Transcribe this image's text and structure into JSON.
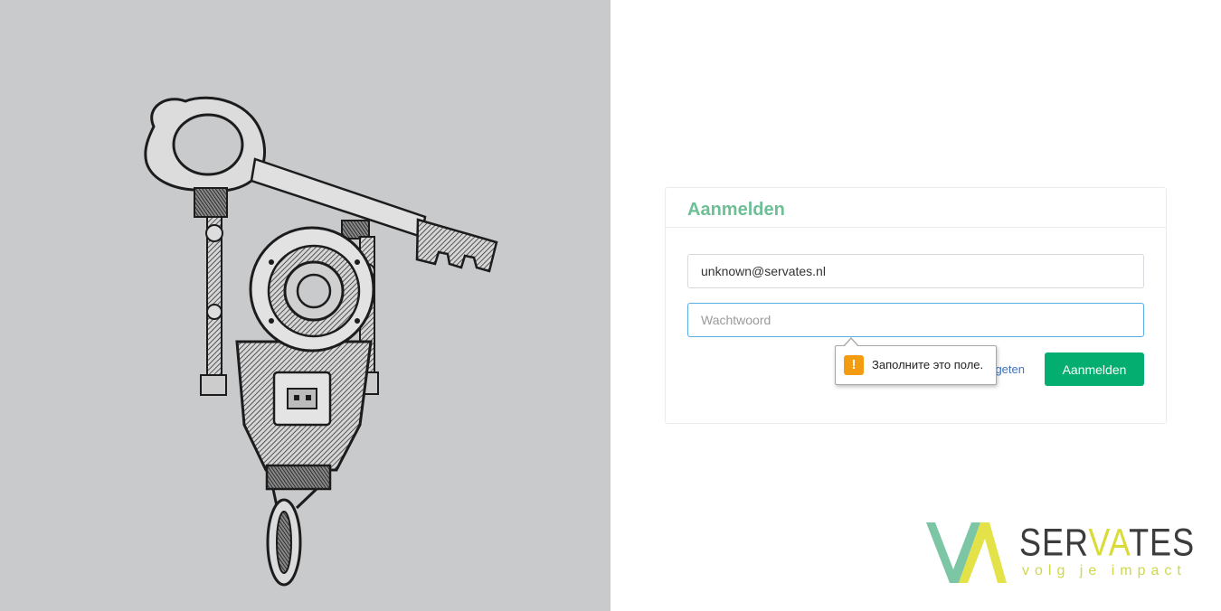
{
  "login": {
    "title": "Aanmelden",
    "email_value": "unknown@servates.nl",
    "password_placeholder": "Wachtwoord",
    "forgot_link": "geten",
    "submit_label": "Aanmelden"
  },
  "tooltip": {
    "icon": "warning-icon",
    "icon_glyph": "!",
    "text": "Заполните это поле."
  },
  "logo": {
    "name_part1": "SER",
    "name_part2": "VA",
    "name_part3": "TES",
    "tagline": "volg je impact"
  },
  "colors": {
    "left_panel": "#c9cacc",
    "heading": "#6dbf95",
    "button": "#03ae70",
    "focus_border": "#5aaee8",
    "link": "#3d72c2",
    "warning": "#f39c12",
    "logo_teal": "#7cc6a5",
    "logo_yellow": "#e2df3a"
  }
}
